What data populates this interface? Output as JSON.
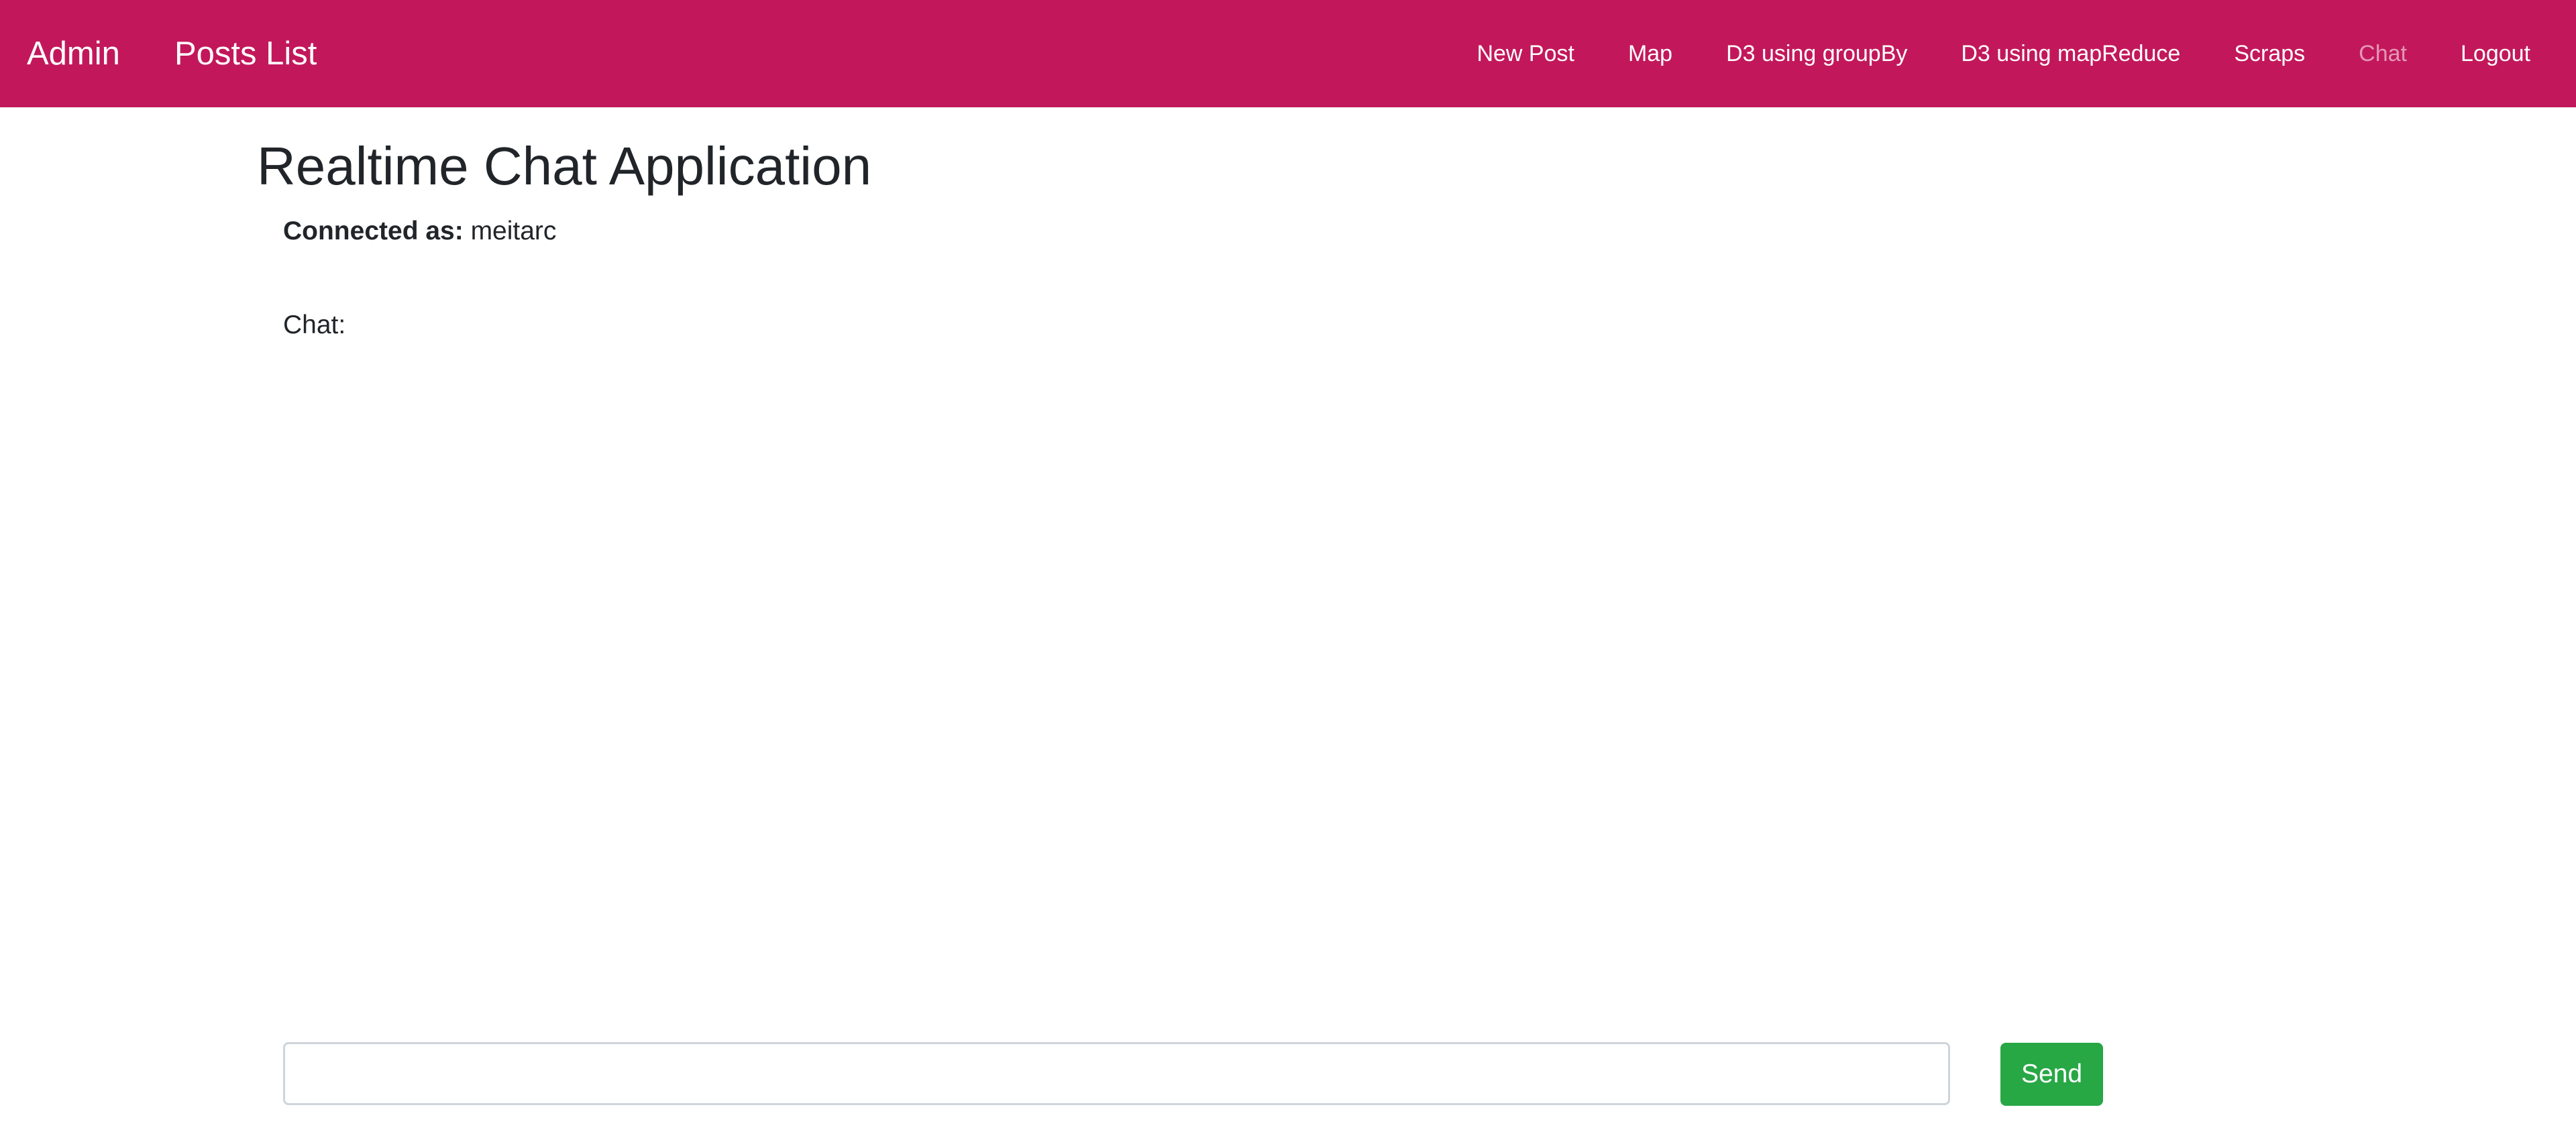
{
  "navbar": {
    "brand": "Admin",
    "posts_list": "Posts List",
    "links": [
      {
        "label": "New Post",
        "active": false
      },
      {
        "label": "Map",
        "active": false
      },
      {
        "label": "D3 using groupBy",
        "active": false
      },
      {
        "label": "D3 using mapReduce",
        "active": false
      },
      {
        "label": "Scraps",
        "active": false
      },
      {
        "label": "Chat",
        "active": true
      },
      {
        "label": "Logout",
        "active": false
      }
    ],
    "colors": {
      "background": "#c2185b",
      "text": "#ffffff",
      "active_text": "#f0a3c1"
    }
  },
  "main": {
    "title": "Realtime Chat Application",
    "connected_label": "Connected as:",
    "connected_user": "meitarc",
    "chat_label": "Chat:",
    "messages": []
  },
  "composer": {
    "input_value": "",
    "input_placeholder": "",
    "send_label": "Send",
    "send_color": "#28a745"
  }
}
